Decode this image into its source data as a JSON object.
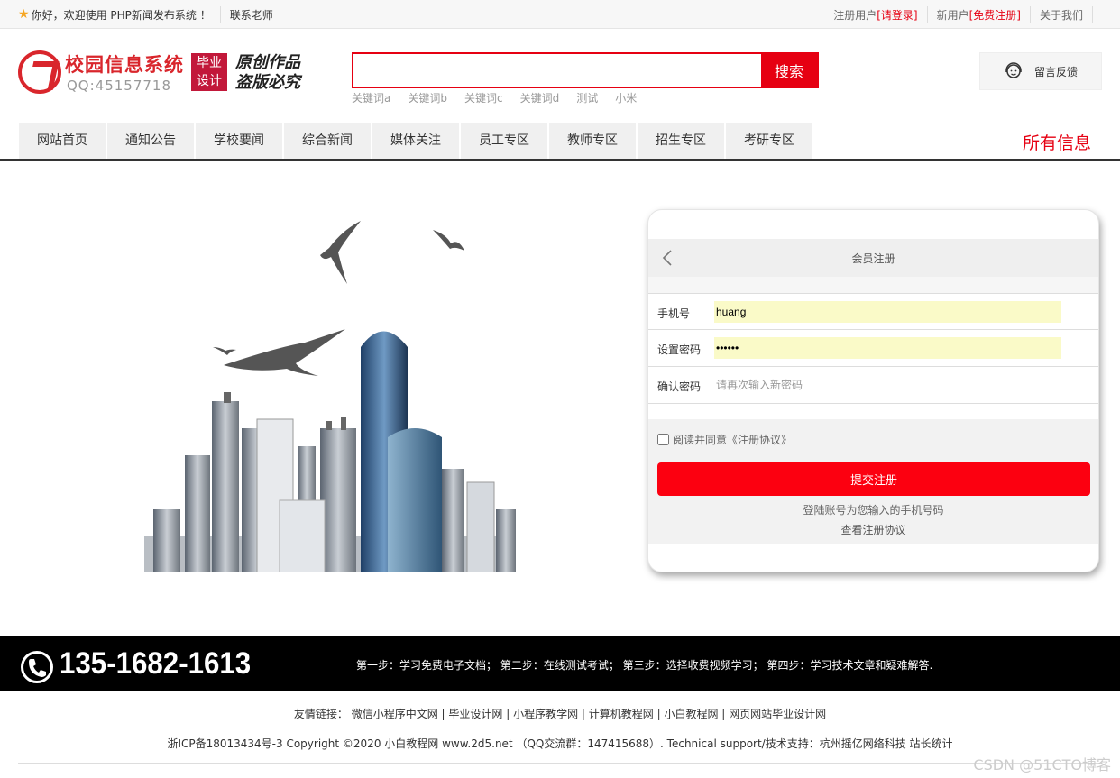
{
  "topbar": {
    "welcome": "你好，欢迎使用 PHP新闻发布系统 ！",
    "contact": "联系老师",
    "register_user_prefix": "注册用户",
    "login": "[请登录]",
    "new_user_prefix": "新用户",
    "free_register": "[免费注册]",
    "about": "关于我们"
  },
  "brand": {
    "name": "校园信息系统",
    "qq": "QQ:45157718",
    "badge_line1": "毕业",
    "badge_line2": "设计",
    "slogan_line1": "原创作品",
    "slogan_line2": "盗版必究"
  },
  "search": {
    "placeholder": "",
    "button": "搜索",
    "keywords": [
      "关键词a",
      "关键词b",
      "关键词c",
      "关键词d",
      "测试",
      "小米"
    ]
  },
  "feedback": {
    "label": "留言反馈"
  },
  "nav": {
    "items": [
      "网站首页",
      "通知公告",
      "学校要闻",
      "综合新闻",
      "媒体关注",
      "员工专区",
      "教师专区",
      "招生专区",
      "考研专区"
    ],
    "all_info": "所有信息"
  },
  "form": {
    "title": "会员注册",
    "phone_label": "手机号",
    "phone_value": "huang",
    "password_label": "设置密码",
    "password_value": "••••••",
    "confirm_label": "确认密码",
    "confirm_placeholder": "请再次输入新密码",
    "agree_text": "阅读并同意《注册协议》",
    "submit": "提交注册",
    "tip": "登陆账号为您输入的手机号码",
    "view_agreement": "查看注册协议"
  },
  "footer": {
    "phone": "135-1682-1613",
    "steps": "第一步：学习免费电子文档；  第二步：在线测试考试；  第三步：选择收费视频学习；  第四步：学习技术文章和疑难解答.",
    "links_label": "友情链接：",
    "links": [
      "微信小程序中文网",
      "毕业设计网",
      "小程序教学网",
      "计算机教程网",
      "小白教程网",
      "网页网站毕业设计网"
    ],
    "copyright": "浙ICP备18013434号-3 Copyright ©2020 小白教程网 www.2d5.net （QQ交流群：147415688）. Technical support/技术支持：杭州摇亿网络科技 站长统计",
    "watermark": "CSDN @51CTO博客"
  },
  "colors": {
    "accent": "#e60012",
    "brand": "#d9262c",
    "input_fill": "#fafac8"
  }
}
